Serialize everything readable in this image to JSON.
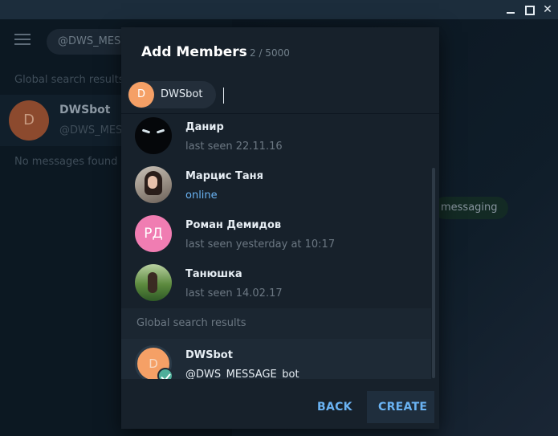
{
  "window": {
    "minimize_glyph": "",
    "maximize_glyph": "",
    "close_glyph": "✕"
  },
  "background": {
    "search_text": "@DWS_MES",
    "section_label": "Global search results",
    "chat_avatar_letter": "D",
    "chat_name": "DWSbot",
    "chat_username": "@DWS_MES",
    "no_messages": "No messages found",
    "pill_text": "messaging"
  },
  "dialog": {
    "title": "Add Members",
    "count": "2 / 5000",
    "chip": {
      "avatar_letter": "D",
      "label": "DWSbot"
    },
    "contacts": [
      {
        "name": "Данир",
        "status": "last seen 22.11.16",
        "online": false,
        "avatar": "danir-photo"
      },
      {
        "name": "Марцис Таня",
        "status": "online",
        "online": true,
        "avatar": "tanya-photo"
      },
      {
        "name": "Роман Демидов",
        "status": "last seen yesterday at 10:17",
        "online": false,
        "avatar": "РД"
      },
      {
        "name": "Танюшка",
        "status": "last seen 14.02.17",
        "online": false,
        "avatar": "tanyushka-photo"
      }
    ],
    "global_section_label": "Global search results",
    "global_result": {
      "avatar_letter": "D",
      "name": "DWSbot",
      "username": "@DWS_MESSAGE_bot",
      "selected": true
    },
    "buttons": {
      "back": "BACK",
      "create": "CREATE"
    }
  },
  "colors": {
    "accent": "#6ab3f3",
    "dialog_bg": "#17212b",
    "online": "#6ab3f3",
    "selected_check": "#4fae9a",
    "avatar_orange": "#f5a066",
    "avatar_pink": "#f07db2"
  }
}
